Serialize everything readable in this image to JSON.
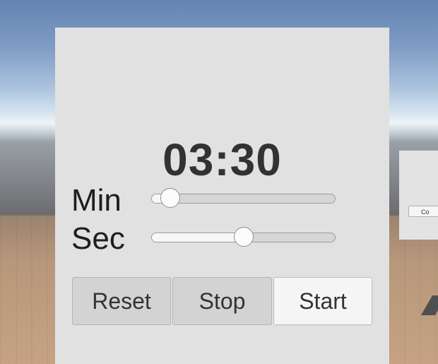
{
  "timer": {
    "display": "03:30"
  },
  "labels": {
    "min": "Min",
    "sec": "Sec"
  },
  "sliders": {
    "min": {
      "value_fraction": 0.1
    },
    "sec": {
      "value_fraction": 0.5
    }
  },
  "buttons": {
    "reset": "Reset",
    "stop": "Stop",
    "start": "Start"
  },
  "side_panel": {
    "button_label": "Co"
  },
  "colors": {
    "panel_bg": "#e1e1e1",
    "timer_text": "#323232",
    "button_bg": "#d3d3d3",
    "start_button_bg": "#f5f5f5"
  }
}
